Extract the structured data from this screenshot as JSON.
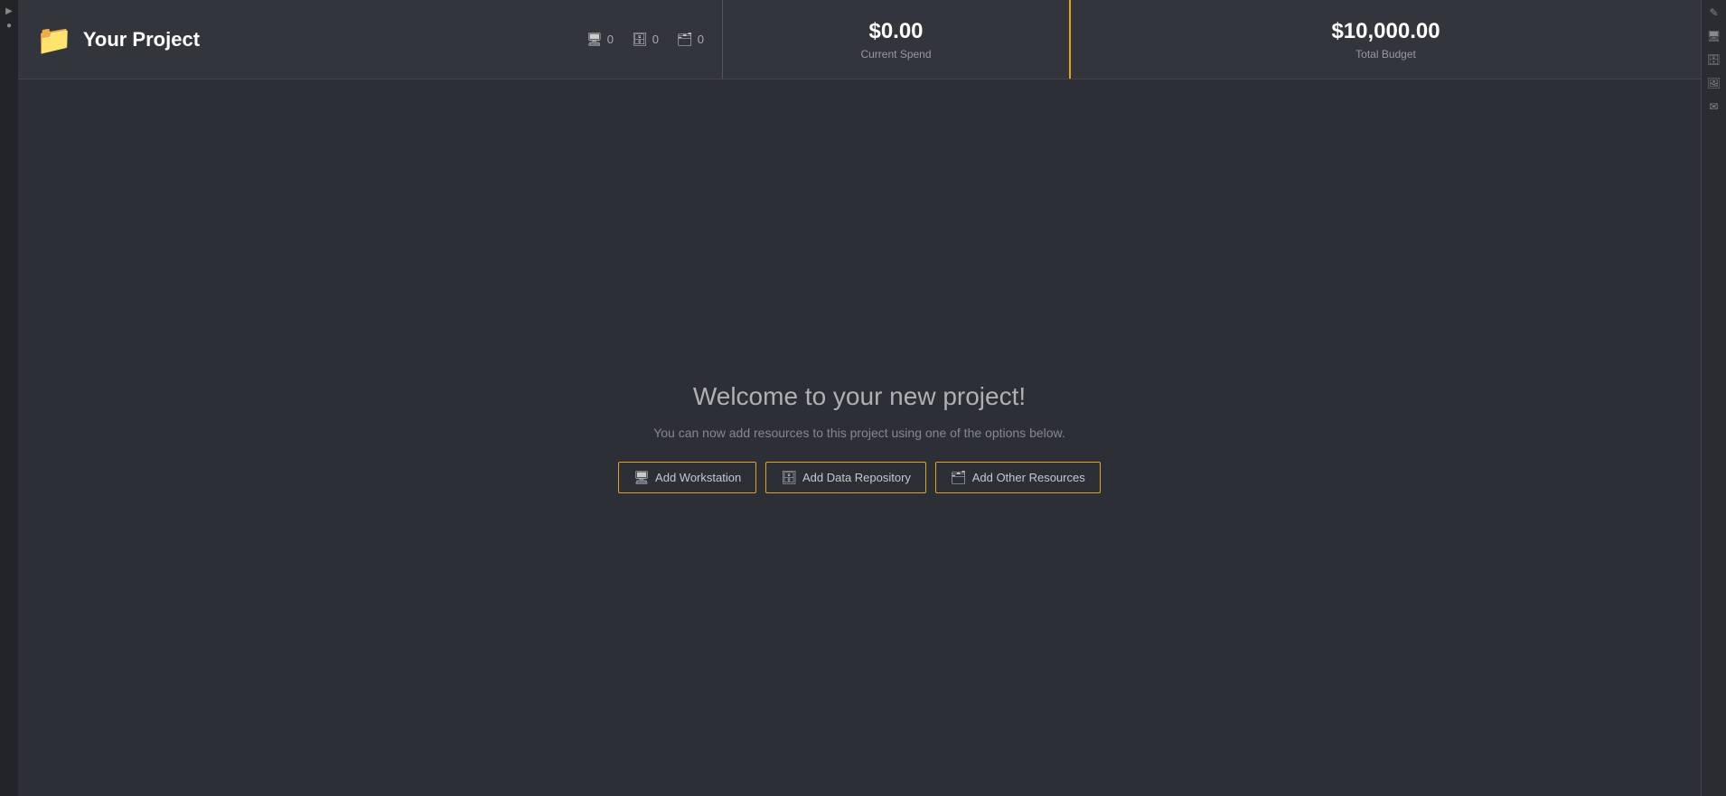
{
  "leftSidebar": {
    "icons": [
      "▶",
      "●"
    ]
  },
  "header": {
    "project": {
      "folderIcon": "📁",
      "title": "Your Project",
      "resourceCounts": [
        {
          "icon": "🖥",
          "count": "0",
          "name": "workstations"
        },
        {
          "icon": "🗄",
          "count": "0",
          "name": "repositories"
        },
        {
          "icon": "🗂",
          "count": "0",
          "name": "other"
        }
      ]
    },
    "spend": {
      "amount": "$0.00",
      "label": "Current Spend"
    },
    "budget": {
      "amount": "$10,000.00",
      "label": "Total Budget"
    }
  },
  "main": {
    "welcome": {
      "title": "Welcome to your new project!",
      "subtitle": "You can now add resources to this project using one of the options below."
    },
    "buttons": [
      {
        "id": "add-workstation",
        "icon": "🖥",
        "label": "Add Workstation"
      },
      {
        "id": "add-data-repository",
        "icon": "🗄",
        "label": "Add Data Repository"
      },
      {
        "id": "add-other-resources",
        "icon": "🗂",
        "label": "Add Other Resources"
      }
    ]
  },
  "rightSidebar": {
    "icons": [
      "✎",
      "🖥",
      "🗄",
      "🖼",
      "✉"
    ]
  }
}
